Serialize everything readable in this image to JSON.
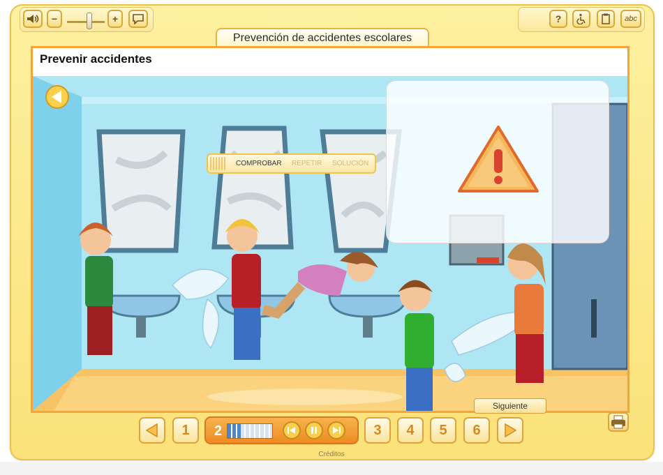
{
  "window": {
    "title": "Prevención de accidentes escolares"
  },
  "toolbar": {
    "left": [
      {
        "name": "volume-icon"
      },
      {
        "name": "volume-down-button",
        "label": "−"
      },
      {
        "name": "volume-up-button",
        "label": "+"
      },
      {
        "name": "speech-bubble-icon"
      }
    ],
    "right": [
      {
        "name": "help-button",
        "label": "?"
      },
      {
        "name": "accessibility-icon"
      },
      {
        "name": "notes-icon"
      },
      {
        "name": "abc-button",
        "label": "abc"
      }
    ]
  },
  "activity": {
    "title": "Prevenir accidentes",
    "check_bar": {
      "check": "COMPROBAR",
      "repeat": "REPETIR",
      "solution": "SOLUCIÓN"
    },
    "next_label": "Siguiente"
  },
  "nav": {
    "pages": [
      "1",
      "2",
      "3",
      "4",
      "5",
      "6"
    ],
    "current_page": "2",
    "progress_fraction": 0.3
  },
  "footer": {
    "credits": "Créditos"
  },
  "colors": {
    "frame": "#fbe27a",
    "accent": "#f3a53a",
    "warning": "#f28d3c",
    "sky": "#aee6f4"
  }
}
